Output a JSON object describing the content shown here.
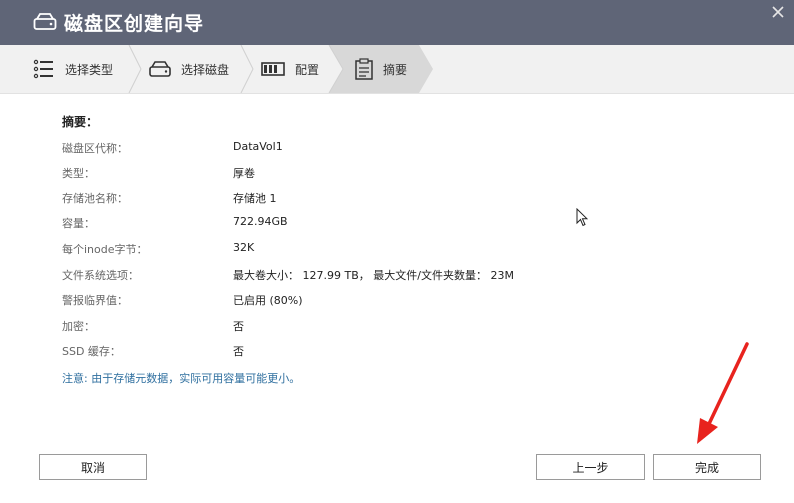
{
  "window": {
    "title": "磁盘区创建向导",
    "close_icon": "close-icon"
  },
  "steps": [
    {
      "label": "选择类型",
      "icon": "list-icon",
      "active": false
    },
    {
      "label": "选择磁盘",
      "icon": "disk-icon",
      "active": false
    },
    {
      "label": "配置",
      "icon": "config-icon",
      "active": false
    },
    {
      "label": "摘要",
      "icon": "clipboard-icon",
      "active": true
    }
  ],
  "summary": {
    "heading": "摘要：",
    "rows": [
      {
        "label": "磁盘区代称：",
        "value": "DataVol1"
      },
      {
        "label": "类型：",
        "value": "厚卷"
      },
      {
        "label": "存储池名称：",
        "value": "存储池 1"
      },
      {
        "label": "容量：",
        "value": "722.94GB"
      },
      {
        "label": "每个inode字节：",
        "value": "32K"
      },
      {
        "label": "文件系统选项：",
        "value": "最大卷大小： 127.99 TB， 最大文件/文件夹数量： 23M"
      },
      {
        "label": "警报临界值：",
        "value": "已启用 (80%)"
      },
      {
        "label": "加密：",
        "value": "否"
      },
      {
        "label": "SSD 缓存：",
        "value": "否"
      }
    ],
    "note": "注意: 由于存储元数据，实际可用容量可能更小。"
  },
  "buttons": {
    "cancel": "取消",
    "back": "上一步",
    "finish": "完成"
  },
  "colors": {
    "titlebar": "#5f6577",
    "stepbar": "#f1f1f1",
    "active_step": "#d8d8d8",
    "note": "#2f6f9f",
    "annotation_arrow": "#e8231e"
  }
}
